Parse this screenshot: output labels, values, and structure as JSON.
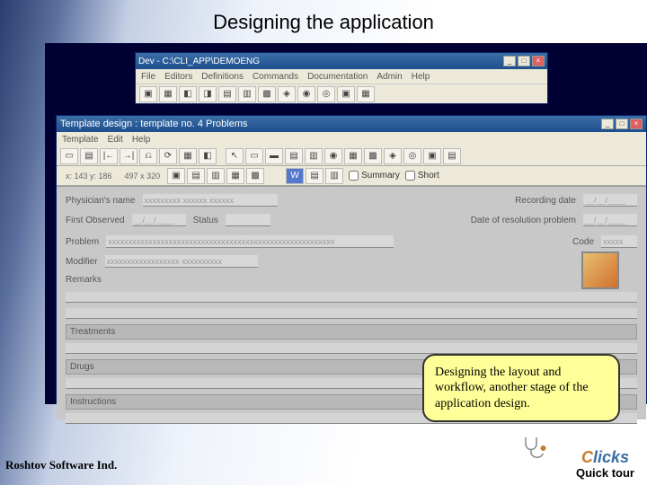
{
  "title": "Designing the application",
  "win1": {
    "title": "Dev - C:\\CLI_APP\\DEMOENG",
    "menu": [
      "File",
      "Editors",
      "Definitions",
      "Commands",
      "Documentation",
      "Admin",
      "Help"
    ]
  },
  "win2": {
    "title": "Template design : template no. 4  Problems",
    "menu": [
      "Template",
      "Edit",
      "Help"
    ],
    "coords1": "x: 143  y: 186",
    "coords2": "497 x 320",
    "chk_summary": "Summary",
    "chk_short": "Short"
  },
  "form": {
    "phys_lbl": "Physician's name",
    "phys_val": "xxxxxxxxx xxxxxx xxxxxx",
    "recdate_lbl": "Recording date",
    "recdate_val": "__/__/____",
    "first_lbl": "First Observed",
    "first_val": "__/__/____",
    "status_lbl": "Status",
    "resol_lbl": "Date of resolution problem",
    "resol_val": "__/__/____",
    "problem_lbl": "Problem",
    "problem_val": "xxxxxxxxxxxxxxxxxxxxxxxxxxxxxxxxxxxxxxxxxxxxxxxxxxxxxxxx",
    "code_lbl": "Code",
    "code_val": "xxxxx",
    "modifier_lbl": "Modifier",
    "modifier_val": "xxxxxxxxxxxxxxxxxx xxxxxxxxxx",
    "remarks_lbl": "Remarks",
    "treatments_lbl": "Treatments",
    "drugs_lbl": "Drugs",
    "instructions_lbl": "Instructions"
  },
  "callout": "Designing the layout and workflow, another stage of the application design.",
  "footer_left": "Roshtov Software Ind.",
  "footer_right": "Quick tour",
  "logo": {
    "c": "C",
    "licks": "licks"
  }
}
